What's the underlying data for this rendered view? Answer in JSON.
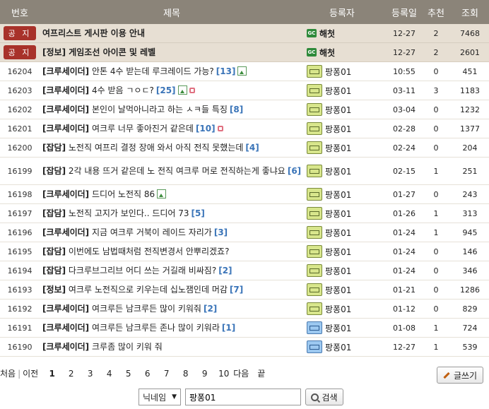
{
  "header": {
    "no": "번호",
    "title": "제목",
    "author": "등록자",
    "date": "등록일",
    "rec": "추천",
    "views": "조회"
  },
  "notices": [
    {
      "badge": "공 지",
      "title": "여프리스트 게시판 이용 안내",
      "author": "해첫",
      "date": "12-27",
      "rec": "2",
      "views": "7468"
    },
    {
      "badge": "공 지",
      "title": "[정보] 게임조선 아이콘 및 레벨",
      "author": "해첫",
      "date": "12-27",
      "rec": "2",
      "views": "2601"
    }
  ],
  "rows": [
    {
      "no": "16204",
      "cat": "[크루세이더]",
      "title": "안톤 4수 받는데 루크레이드 가능?",
      "cmt": "[13]",
      "img": true,
      "new": false,
      "author": "팡퐁01",
      "lv": "green",
      "date": "10:55",
      "rec": "0",
      "views": "451"
    },
    {
      "no": "16203",
      "cat": "[크루세이더]",
      "title": "4수 받음 ㄱㅇㄷ?",
      "cmt": "[25]",
      "img": true,
      "new": true,
      "author": "팡퐁01",
      "lv": "green",
      "date": "03-11",
      "rec": "3",
      "views": "1183"
    },
    {
      "no": "16202",
      "cat": "[크루세이더]",
      "title": "본인이 날먹아니라고 하는 ㅅㅋ들 특징",
      "cmt": "[8]",
      "img": false,
      "new": false,
      "author": "팡퐁01",
      "lv": "green",
      "date": "03-04",
      "rec": "0",
      "views": "1232"
    },
    {
      "no": "16201",
      "cat": "[크루세이더]",
      "title": "여크루 너무 좋아진거 같은데",
      "cmt": "[10]",
      "img": false,
      "new": true,
      "author": "팡퐁01",
      "lv": "green",
      "date": "02-28",
      "rec": "0",
      "views": "1377"
    },
    {
      "no": "16200",
      "cat": "[잡담]",
      "title": "노전직 여프리 결정 장애 와서 아직 전직 못했는데",
      "cmt": "[4]",
      "img": false,
      "new": false,
      "author": "팡퐁01",
      "lv": "green",
      "date": "02-24",
      "rec": "0",
      "views": "204"
    },
    {
      "no": "16199",
      "cat": "[잡담]",
      "title": "2각 내용 뜨거 같은데 노 전직 여크루 머로 전직하는게 좋냐요",
      "cmt": "[6]",
      "img": false,
      "new": false,
      "author": "팡퐁01",
      "lv": "green",
      "date": "02-15",
      "rec": "1",
      "views": "251",
      "tall": true
    },
    {
      "no": "16198",
      "cat": "[크루세이더]",
      "title": "드디어 노전직 86",
      "cmt": "",
      "img": true,
      "new": false,
      "author": "팡퐁01",
      "lv": "green",
      "date": "01-27",
      "rec": "0",
      "views": "243"
    },
    {
      "no": "16197",
      "cat": "[잡담]",
      "title": "노전직 고지가 보인다.. 드디어 73",
      "cmt": "[5]",
      "img": false,
      "new": false,
      "author": "팡퐁01",
      "lv": "green",
      "date": "01-26",
      "rec": "1",
      "views": "313"
    },
    {
      "no": "16196",
      "cat": "[크루세이더]",
      "title": "지금 여크루 거북이 레이드 자리가",
      "cmt": "[3]",
      "img": false,
      "new": false,
      "author": "팡퐁01",
      "lv": "green",
      "date": "01-24",
      "rec": "1",
      "views": "945"
    },
    {
      "no": "16195",
      "cat": "[잡담]",
      "title": "이번에도 남법때처럼 전직변경서 안뿌리겠죠?",
      "cmt": "",
      "img": false,
      "new": false,
      "author": "팡퐁01",
      "lv": "green",
      "date": "01-24",
      "rec": "0",
      "views": "146"
    },
    {
      "no": "16194",
      "cat": "[잡담]",
      "title": "다크루브그리브 어디 쓰는 거길래 비싸짐?",
      "cmt": "[2]",
      "img": false,
      "new": false,
      "author": "팡퐁01",
      "lv": "green",
      "date": "01-24",
      "rec": "0",
      "views": "346"
    },
    {
      "no": "16193",
      "cat": "[정보]",
      "title": "여크루 노전직으로 키우는데 십노잼인데 머감",
      "cmt": "[7]",
      "img": false,
      "new": false,
      "author": "팡퐁01",
      "lv": "green",
      "date": "01-21",
      "rec": "0",
      "views": "1286"
    },
    {
      "no": "16192",
      "cat": "[크루세이더]",
      "title": "여크루든 남크루든 많이 키워줘",
      "cmt": "[2]",
      "img": false,
      "new": false,
      "author": "팡퐁01",
      "lv": "green",
      "date": "01-12",
      "rec": "0",
      "views": "829"
    },
    {
      "no": "16191",
      "cat": "[크루세이더]",
      "title": "여크루든 남크루든 존나 많이 키워라",
      "cmt": "[1]",
      "img": false,
      "new": false,
      "author": "팡퐁01",
      "lv": "blue",
      "date": "01-08",
      "rec": "1",
      "views": "724"
    },
    {
      "no": "16190",
      "cat": "[크루세이더]",
      "title": "크루좀 많이 키워 줘",
      "cmt": "",
      "img": false,
      "new": false,
      "author": "팡퐁01",
      "lv": "blue",
      "date": "12-27",
      "rec": "1",
      "views": "539"
    }
  ],
  "pager": {
    "first": "처음",
    "prev": "이전",
    "pages": [
      "1",
      "2",
      "3",
      "4",
      "5",
      "6",
      "7",
      "8",
      "9",
      "10"
    ],
    "current": "1",
    "next": "다음",
    "last": "끝"
  },
  "write_label": "글쓰기",
  "search": {
    "select": "닉네임",
    "value": "팡퐁01",
    "button": "검색"
  }
}
